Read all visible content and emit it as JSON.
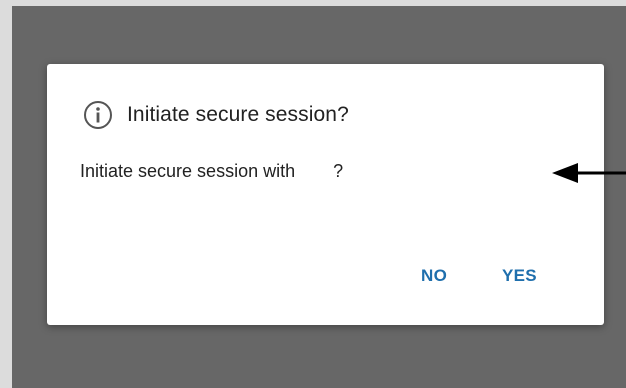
{
  "dialog": {
    "title": "Initiate secure session?",
    "message_prefix": "Initiate secure session with",
    "message_suffix": "?",
    "buttons": {
      "no_label": "NO",
      "yes_label": "YES"
    }
  },
  "icons": {
    "title_icon": "info-icon",
    "annotation": "arrow-left-icon"
  },
  "colors": {
    "overlay": "#676767",
    "dialog_bg": "#ffffff",
    "button_text": "#1f6fad",
    "text": "#222222"
  }
}
